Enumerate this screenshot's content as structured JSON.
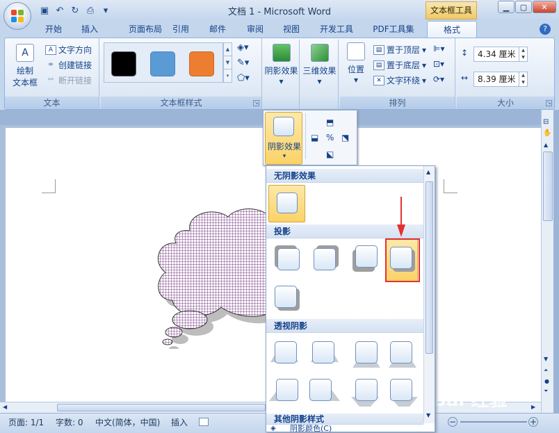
{
  "window": {
    "title": "文档 1 - Microsoft Word",
    "context_tools": "文本框工具"
  },
  "tabs": [
    "开始",
    "插入",
    "页面布局",
    "引用",
    "邮件",
    "审阅",
    "视图",
    "开发工具",
    "PDF工具集",
    "格式"
  ],
  "ribbon": {
    "text_group": {
      "label": "文本",
      "draw_textbox": "绘制",
      "draw_textbox2": "文本框",
      "text_direction": "文字方向",
      "create_link": "创建链接",
      "break_link": "断开链接"
    },
    "style_group": {
      "label": "文本框样式",
      "swatches": [
        "#000000",
        "#5b9bd5",
        "#ed7d31"
      ]
    },
    "shadow": {
      "label": "阴影效果",
      "caret": "▾"
    },
    "threed": {
      "label": "三维效果",
      "caret": "▾"
    },
    "arrange_group": {
      "label": "排列",
      "position": "位置",
      "bring_front": "置于顶层",
      "send_back": "置于底层",
      "wrap": "文字环绕"
    },
    "size_group": {
      "label": "大小",
      "height": "4.34 厘米",
      "width": "8.39 厘米"
    }
  },
  "popup_shadow": {
    "label": "阴影效果",
    "caret": "▾"
  },
  "shadow_gallery": {
    "no_shadow": "无阴影效果",
    "drop_shadow": "投影",
    "perspective": "透视阴影",
    "other": "其他阴影样式",
    "shadow_color": "阴影颜色(C)"
  },
  "status": {
    "page": "页面: 1/1",
    "words": "字数: 0",
    "lang": "中文(简体，中国)",
    "mode": "插入",
    "zoom": "Bai 经验"
  },
  "colors": {
    "accent": "#e23131",
    "cloud_fill": "#7a3a86"
  }
}
